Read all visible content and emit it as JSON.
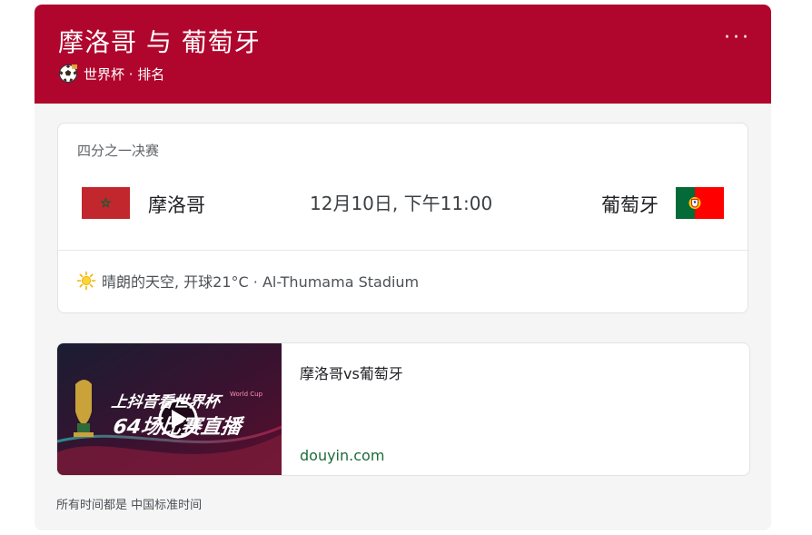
{
  "header": {
    "title": "摩洛哥 与 葡萄牙",
    "subtitle": "世界杯 · 排名",
    "sport_icon": "soccer-ball-icon",
    "menu_label": "···",
    "background_color": "#b0062e"
  },
  "match": {
    "stage": "四分之一决赛",
    "home_team": "摩洛哥",
    "away_team": "葡萄牙",
    "time": "12月10日, 下午11:00",
    "home_flag": "morocco-flag",
    "away_flag": "portugal-flag",
    "weather_icon": "sun-icon",
    "weather": "晴朗的天空, 开球21°C · Al-Thumama Stadium"
  },
  "video": {
    "title": "摩洛哥vs葡萄牙",
    "source": "douyin.com",
    "thumbnail_text_line1": "上抖音看世界杯",
    "thumbnail_text_line2": "64场比赛直播",
    "thumbnail_badge": "World Cup",
    "play_icon": "play-icon"
  },
  "footer": {
    "note": "所有时间都是 中国标准时间"
  },
  "colors": {
    "brand": "#b0062e",
    "link_green": "#1e6b38"
  }
}
